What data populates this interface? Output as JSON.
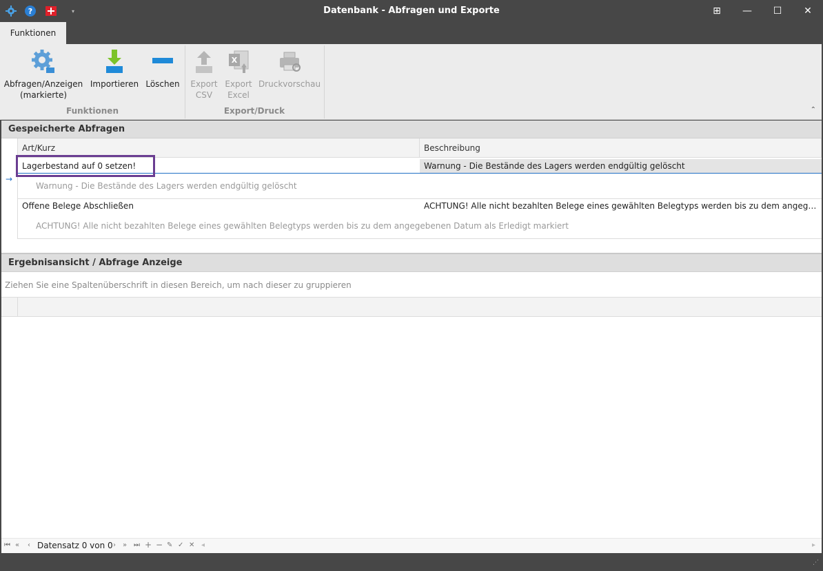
{
  "window": {
    "title": "Datenbank - Abfragen und Exporte",
    "buttons": {
      "restore_panel": "⊞",
      "minimize": "—",
      "maximize": "☐",
      "close": "✕"
    }
  },
  "quick_access": {
    "icons": [
      "gear-icon",
      "help-icon",
      "swiss-flag-icon",
      "dropdown-arrow-icon"
    ]
  },
  "ribbon": {
    "tab": "Funktionen",
    "groups": [
      {
        "label": "Funktionen",
        "buttons": [
          {
            "label": "Abfragen/Anzeigen\n(markierte)",
            "icon": "gear-icon",
            "enabled": true
          },
          {
            "label": "Importieren",
            "icon": "import-arrow-icon",
            "enabled": true
          },
          {
            "label": "Löschen",
            "icon": "minus-icon",
            "enabled": true
          }
        ]
      },
      {
        "label": "Export/Druck",
        "buttons": [
          {
            "label": "Export\nCSV",
            "icon": "export-up-arrow-icon",
            "enabled": false
          },
          {
            "label": "Export\nExcel",
            "icon": "excel-icon",
            "enabled": false
          },
          {
            "label": "Druckvorschau",
            "icon": "print-preview-icon",
            "enabled": false
          }
        ]
      }
    ]
  },
  "saved_queries": {
    "title": "Gespeicherte Abfragen",
    "columns": [
      "Art/Kurz",
      "Beschreibung"
    ],
    "rows": [
      {
        "art": "Lagerbestand auf 0 setzen!",
        "beschreibung": "Warnung - Die Bestände des Lagers werden endgültig gelöscht",
        "preview": "Warnung - Die Bestände des Lagers werden endgültig gelöscht",
        "selected": true
      },
      {
        "art": "Offene Belege Abschließen",
        "beschreibung": "ACHTUNG! Alle nicht bezahlten Belege eines gewählten Belegtyps werden bis zu dem angegebene...",
        "preview": "ACHTUNG! Alle nicht bezahlten Belege eines gewählten Belegtyps werden bis zu dem angegebenen Datum als Erledigt markiert",
        "selected": false
      }
    ]
  },
  "results": {
    "title": "Ergebnisansicht / Abfrage Anzeige",
    "group_hint": "Ziehen Sie eine Spaltenüberschrift in diesen Bereich, um nach dieser zu gruppieren"
  },
  "navigator": {
    "record_text": "Datensatz 0 von 0",
    "buttons": [
      "⏮",
      "«",
      "‹",
      "›",
      "»",
      "⏭",
      "+",
      "−",
      "✎",
      "✓",
      "✕"
    ]
  },
  "colors": {
    "titlebar": "#474747",
    "ribbon": "#ececec",
    "highlight_box": "#6a3d91",
    "selected_row_desc": "#e4e4e4",
    "focus_line": "#1f6fc5"
  }
}
